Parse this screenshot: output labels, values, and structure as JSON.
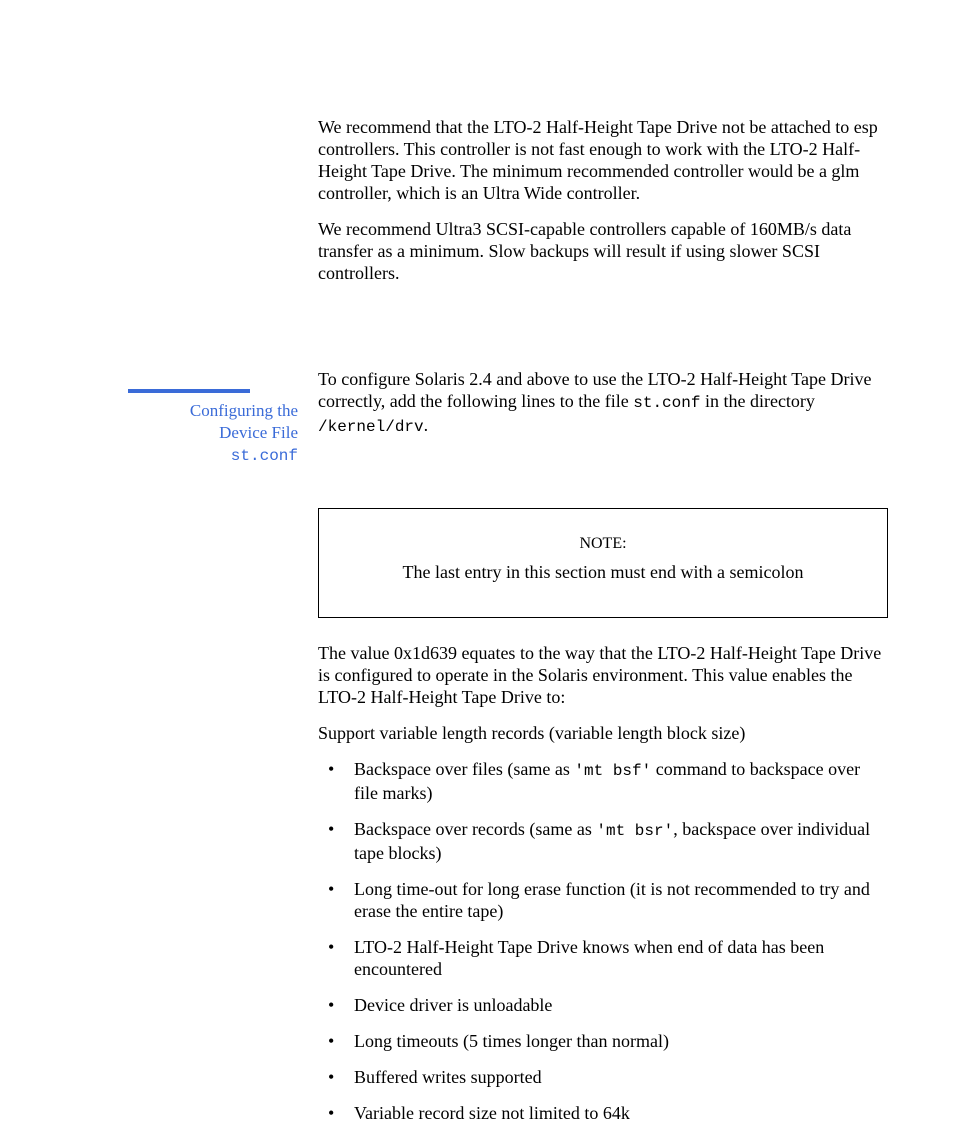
{
  "paragraphs": {
    "p1": "We recommend that the LTO-2 Half-Height Tape Drive not be attached to esp controllers. This controller is not fast enough to work with the LTO-2 Half-Height Tape Drive. The minimum recommended controller would be a glm controller, which is an Ultra Wide controller.",
    "p2": "We recommend Ultra3 SCSI-capable controllers capable of 160MB/s data transfer as a minimum. Slow backups will result if using slower SCSI controllers."
  },
  "section": {
    "label_l1": "Configuring the",
    "label_l2": "Device File",
    "label_l3": "st.conf",
    "body_t1": "To configure Solaris 2.4 and above to use the LTO-2 Half-Height Tape Drive correctly, add the following lines to the file ",
    "body_file": "st.conf",
    "body_t2": " in the directory ",
    "body_dir": "/kernel/drv",
    "body_t3": "."
  },
  "note": {
    "label": "NOTE:",
    "text": "The last entry in this section must end with a semicolon"
  },
  "after": {
    "p1": "The value 0x1d639 equates to the way that the LTO-2 Half-Height Tape Drive is configured to operate in the Solaris environment. This value enables the LTO-2 Half-Height Tape Drive to:",
    "p2": "Support variable length records (variable length block size)"
  },
  "bullets": {
    "b1a": "Backspace over files (same as ",
    "b1cmd": "'mt bsf'",
    "b1b": " command to backspace over file marks)",
    "b2a": "Backspace over records (same as ",
    "b2cmd": "'mt bsr'",
    "b2b": ", backspace over individual tape blocks)",
    "b3": "Long time-out for long erase function (it is not recommended to try and erase the entire tape)",
    "b4": "LTO-2 Half-Height Tape Drive knows when end of data has been encountered",
    "b5": "Device driver is unloadable",
    "b6": "Long timeouts (5 times longer than normal)",
    "b7": "Buffered writes supported",
    "b8": "Variable record size not limited to 64k"
  }
}
